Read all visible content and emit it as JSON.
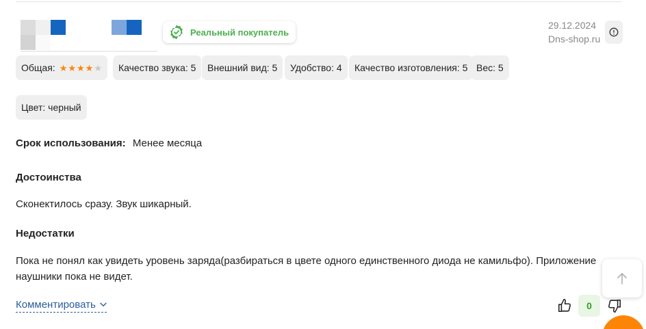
{
  "review": {
    "verified_badge": "Реальный покупатель",
    "date": "29.12.2024",
    "source": "Dns-shop.ru",
    "ratings": [
      {
        "label": "Общая:",
        "stars": 4,
        "max": 5
      },
      {
        "label": "Качество звука: 5"
      },
      {
        "label": "Внешний вид: 5"
      },
      {
        "label": "Удобство: 4"
      },
      {
        "label": "Качество изготовления: 5"
      },
      {
        "label": "Вес: 5"
      }
    ],
    "color_chip": "Цвет: черный",
    "usage_label": "Срок использования:",
    "usage_value": "Менее месяца",
    "pros_title": "Достоинства",
    "pros_text": "Сконектилось сразу. Звук шикарный.",
    "cons_title": "Недостатки",
    "cons_text_line1": "Пока не понял как увидеть уровень заряда(разбираться в цвете одного единственного диода не камильфо).  Приложение",
    "cons_text_line2": "наушники пока не видет.",
    "comment_link": "Комментировать",
    "votes": "0"
  },
  "icons": {
    "verified": "check-badge-icon",
    "report": "exclamation-icon",
    "chevron": "chevron-down-icon",
    "like": "thumbs-up-icon",
    "dislike": "thumbs-down-icon",
    "scroll_top": "arrow-up-icon"
  },
  "colors": {
    "accent_green": "#4caf50",
    "star_orange": "#fc8507",
    "star_empty": "#c8c8c8",
    "link_blue": "#2b5d9b",
    "fab_orange": "#fc8507"
  }
}
